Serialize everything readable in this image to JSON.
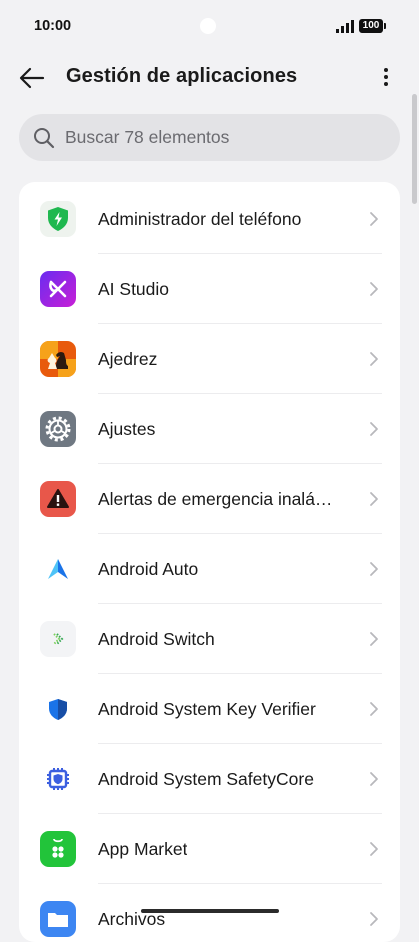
{
  "status_bar": {
    "time": "10:00",
    "battery": "100"
  },
  "header": {
    "title": "Gestión de aplicaciones"
  },
  "search": {
    "placeholder": "Buscar 78 elementos",
    "value": ""
  },
  "apps": [
    {
      "name": "Administrador del teléfono",
      "icon": "phone-manager-shield-icon"
    },
    {
      "name": "AI Studio",
      "icon": "ai-studio-icon"
    },
    {
      "name": "Ajedrez",
      "icon": "chess-icon"
    },
    {
      "name": "Ajustes",
      "icon": "settings-gear-icon"
    },
    {
      "name": "Alertas de emergencia inalá…",
      "icon": "emergency-alert-icon"
    },
    {
      "name": "Android Auto",
      "icon": "android-auto-icon"
    },
    {
      "name": "Android Switch",
      "icon": "android-switch-icon"
    },
    {
      "name": "Android System Key Verifier",
      "icon": "key-verifier-shield-icon"
    },
    {
      "name": "Android System SafetyCore",
      "icon": "safetycore-chip-icon"
    },
    {
      "name": "App Market",
      "icon": "app-market-icon"
    },
    {
      "name": "Archivos",
      "icon": "files-folder-icon"
    }
  ],
  "colors": {
    "background": "#f2f2f4",
    "card": "#ffffff",
    "search_bg": "#e3e3e6",
    "text": "#1a1a1a"
  }
}
